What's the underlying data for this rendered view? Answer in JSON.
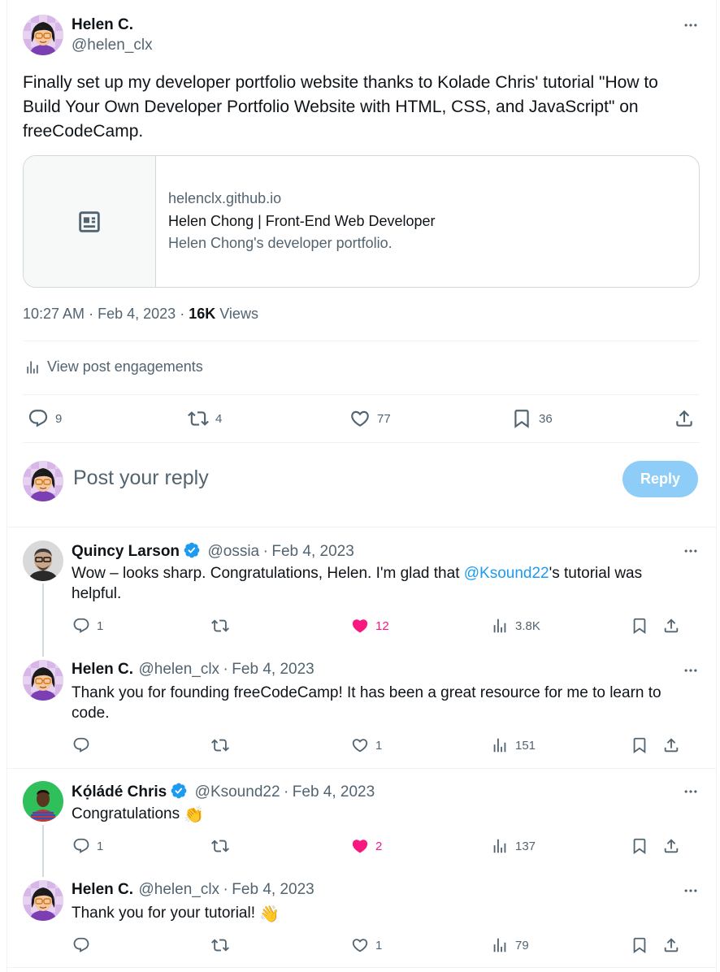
{
  "main": {
    "author_name": "Helen C.",
    "author_handle": "@helen_clx",
    "text": "Finally set up my developer portfolio website thanks to Kolade Chris' tutorial \"How to Build Your Own Developer Portfolio Website with HTML, CSS, and JavaScript\" on freeCodeCamp.",
    "card": {
      "domain": "helenclx.github.io",
      "title": "Helen Chong | Front-End Web Developer",
      "description": "Helen Chong's developer portfolio.",
      "icon": "article-icon"
    },
    "time": "10:27 AM",
    "date": "Feb 4, 2023",
    "views_count": "16K",
    "views_label": "Views",
    "engagements_label": "View post engagements",
    "replies": "9",
    "reposts": "4",
    "likes": "77",
    "bookmarks": "36"
  },
  "compose": {
    "placeholder": "Post your reply",
    "button": "Reply"
  },
  "replies": [
    {
      "name": "Quincy Larson",
      "verified": true,
      "handle": "@ossia",
      "date": "Feb 4, 2023",
      "text_before": "Wow – looks sharp. Congratulations, Helen. I'm glad that ",
      "mention": "@Ksound22",
      "text_after": "'s tutorial was helpful.",
      "replies": "1",
      "reposts": "",
      "likes": "12",
      "liked": true,
      "views": "3.8K"
    },
    {
      "name": "Helen C.",
      "verified": false,
      "handle": "@helen_clx",
      "date": "Feb 4, 2023",
      "text": "Thank you for founding freeCodeCamp! It has been a great resource for me to learn to code.",
      "replies": "",
      "reposts": "",
      "likes": "1",
      "liked": false,
      "views": "151"
    },
    {
      "name": "Kọ́ládé Chris",
      "verified": true,
      "handle": "@Ksound22",
      "date": "Feb 4, 2023",
      "text": "Congratulations",
      "emoji": "👏",
      "replies": "1",
      "reposts": "",
      "likes": "2",
      "liked": true,
      "views": "137"
    },
    {
      "name": "Helen C.",
      "verified": false,
      "handle": "@helen_clx",
      "date": "Feb 4, 2023",
      "text": "Thank you for your tutorial!",
      "emoji": "👋",
      "replies": "",
      "reposts": "",
      "likes": "1",
      "liked": false,
      "views": "79"
    }
  ],
  "separator": "·",
  "colors": {
    "accent": "#1d9bf0",
    "like": "#f91880",
    "muted": "#536471",
    "reply_button": "#8ecdf8"
  }
}
